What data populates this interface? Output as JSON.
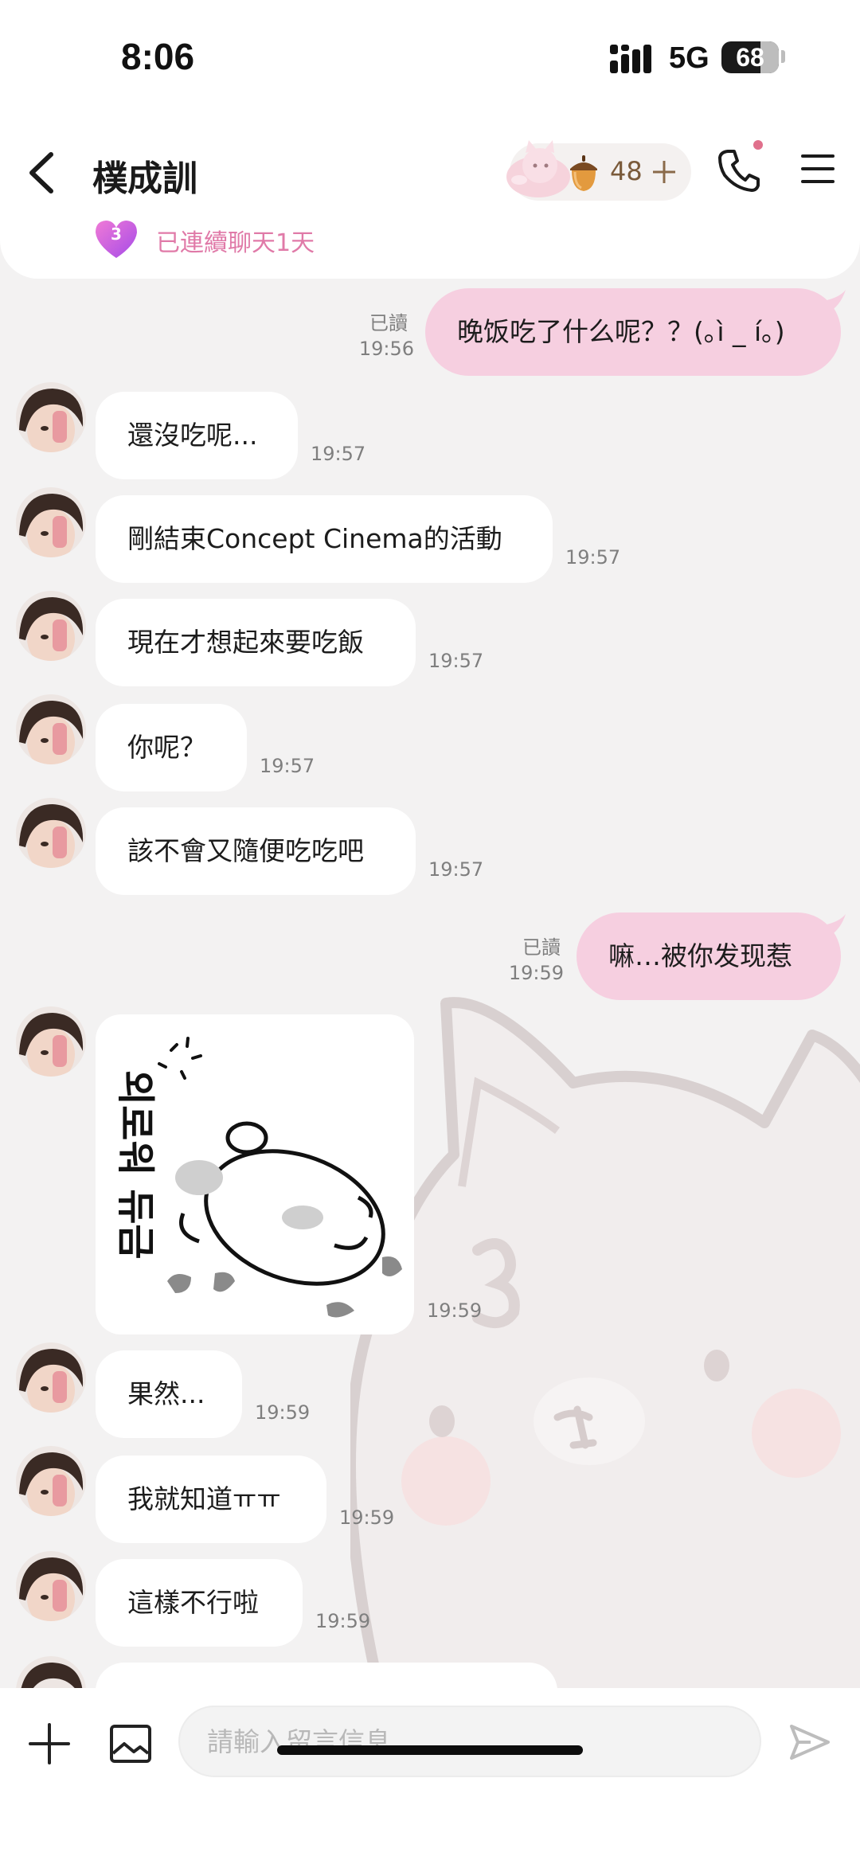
{
  "status_bar": {
    "time": "8:06",
    "network": "5G",
    "battery": "68",
    "battery_level": 0.68
  },
  "header": {
    "contact_name": "樸成訓",
    "acorn_count": "48",
    "streak_days": "3",
    "streak_text": "已連續聊天1天"
  },
  "messages": [
    {
      "side": "out",
      "text": "晚饭吃了什么呢？？(｡ì _ í｡)",
      "read": "已讀",
      "time": "19:56"
    },
    {
      "side": "in",
      "text": "還沒吃呢...",
      "time": "19:57"
    },
    {
      "side": "in",
      "text": "剛結束Concept Cinema的活動",
      "time": "19:57"
    },
    {
      "side": "in",
      "text": "現在才想起來要吃飯",
      "time": "19:57"
    },
    {
      "side": "in",
      "text": "你呢？",
      "time": "19:57"
    },
    {
      "side": "in",
      "text": "該不會又隨便吃吃吧",
      "time": "19:57"
    },
    {
      "side": "out",
      "text": "嘛…被你发现惹",
      "read": "已讀",
      "time": "19:59"
    },
    {
      "side": "in",
      "type": "sticker",
      "sticker_text": "외로워 듀금",
      "time": "19:59"
    },
    {
      "side": "in",
      "text": "果然...",
      "time": "19:59"
    },
    {
      "side": "in",
      "text": "我就知道ㅠㅠ",
      "time": "19:59"
    },
    {
      "side": "in",
      "text": "這樣不行啦",
      "time": "19:59"
    }
  ],
  "input": {
    "placeholder": "請輸入留言信息..."
  },
  "colors": {
    "outgoing_bubble": "#f6cfe0",
    "incoming_bubble": "#ffffff",
    "accent_pink": "#e07aa8",
    "chat_background": "#f3f2f2"
  },
  "icons": [
    "back-arrow-icon",
    "acorn-icon",
    "plus-icon",
    "phone-icon",
    "menu-icon",
    "heart-icon",
    "add-icon",
    "gallery-icon",
    "send-icon"
  ]
}
